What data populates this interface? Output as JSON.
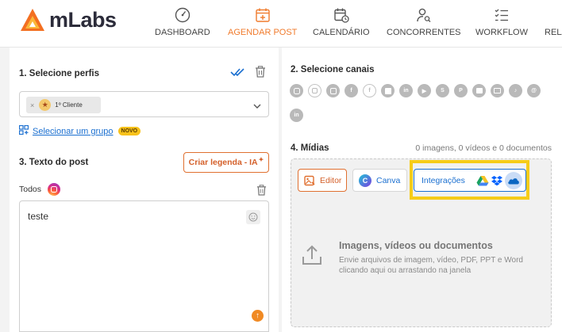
{
  "brand": {
    "name": "mLabs",
    "accent": "#f07b2d"
  },
  "nav": {
    "items": [
      {
        "label": "DASHBOARD",
        "icon": "gauge-icon"
      },
      {
        "label": "AGENDAR POST",
        "icon": "calendar-plus-icon",
        "active": true
      },
      {
        "label": "CALENDÁRIO",
        "icon": "calendar-clock-icon"
      },
      {
        "label": "CONCORRENTES",
        "icon": "user-search-icon"
      },
      {
        "label": "WORKFLOW",
        "icon": "checklist-icon"
      },
      {
        "label": "RELA",
        "icon": "report-icon"
      }
    ]
  },
  "profiles": {
    "title": "1. Selecione perfis",
    "selected_chip": "1º Cliente",
    "group_link": "Selecionar um grupo",
    "badge": "NOVO"
  },
  "channels": {
    "title": "2. Selecione canais",
    "icons": [
      "instagram-icon",
      "instagram-outline-icon",
      "instagram-square-icon",
      "facebook-icon",
      "facebook-outline-icon",
      "facebook-square-icon",
      "linkedin-icon",
      "youtube-icon",
      "pinterest-square-icon",
      "pinterest-icon",
      "google-business-icon",
      "image-gallery-icon",
      "tiktok-icon",
      "threads-icon",
      "linkedin-page-icon"
    ]
  },
  "post_text": {
    "title": "3. Texto do post",
    "ai_button": "Criar legenda - IA",
    "tab_label": "Todos",
    "text": "teste"
  },
  "media": {
    "title": "4. Mídias",
    "count": "0 imagens, 0 vídeos e 0 documentos",
    "editor_button": "Editor",
    "canva_button": "Canva",
    "integrations_button": "Integrações",
    "drop_title": "Imagens, vídeos ou documentos",
    "drop_description": "Envie arquivos de imagem, vídeo, PDF, PPT e Word clicando aqui ou arrastando na janela"
  }
}
